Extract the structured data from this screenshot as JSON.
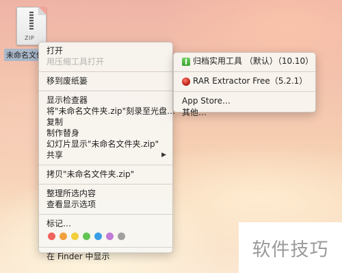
{
  "desktop": {
    "file_tag": "ZIP",
    "file_name": "未命名文件"
  },
  "menu": {
    "items_group1": [
      "打开",
      "用压缩工具打开"
    ],
    "items_group2": [
      "移到废纸篓"
    ],
    "items_group3": [
      "显示检查器",
      "将\"未命名文件夹.zip\"刻录至光盘…",
      "复制",
      "制作替身",
      "幻灯片显示\"未命名文件夹.zip\"",
      "共享"
    ],
    "items_group4": [
      "拷贝\"未命名文件夹.zip\""
    ],
    "items_group5": [
      "整理所选内容",
      "查看显示选项"
    ],
    "tags_label": "标记…",
    "tag_colors": [
      "#f0625c",
      "#f2a03d",
      "#f2cf3b",
      "#62c554",
      "#3a9ee6",
      "#c27ad7",
      "#a0a0a0"
    ],
    "finder_item": "在 Finder 中显示",
    "submenu_arrow": "▶"
  },
  "submenu": {
    "app1_label": "归档实用工具 （默认）（10.10）",
    "app2_label": "RAR Extractor Free（5.2.1）",
    "app_store": "App Store…",
    "other": "其他…"
  },
  "watermark": "软件技巧"
}
